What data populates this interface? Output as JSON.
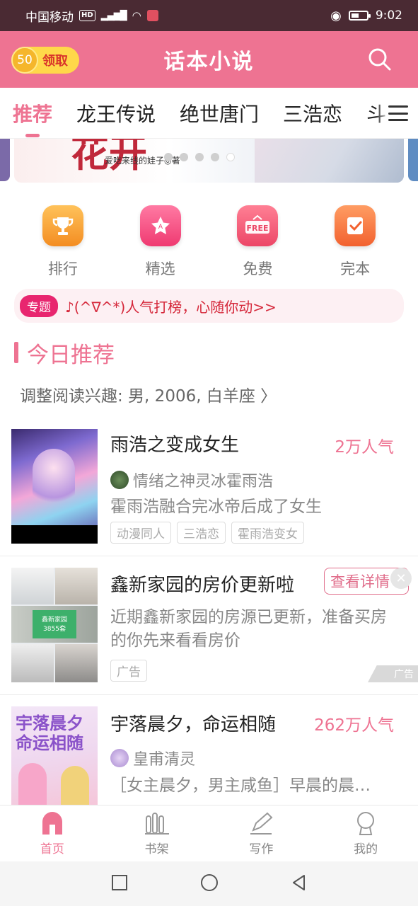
{
  "status_bar": {
    "carrier": "中国移动",
    "hd": "HD",
    "network": "⁴ᴳ",
    "time": "9:02"
  },
  "header": {
    "title": "话本小说",
    "coin_value": "50",
    "coin_label": "领取"
  },
  "tabs": [
    "推荐",
    "龙王传说",
    "绝世唐门",
    "三浩恋",
    "斗"
  ],
  "banner": {
    "title_text": "花开",
    "author_text": "爱吃来线的娃子◎著",
    "dot_count": 5,
    "active_dot": 4
  },
  "categories": [
    {
      "label": "排行",
      "icon": "trophy-icon",
      "color": "#f7a23b"
    },
    {
      "label": "精选",
      "icon": "star-icon",
      "color": "#f25587"
    },
    {
      "label": "免费",
      "icon": "free-icon",
      "color": "#f0577a"
    },
    {
      "label": "完本",
      "icon": "check-icon",
      "color": "#f7723e"
    }
  ],
  "topic": {
    "badge": "专题",
    "text": "♪(^∇^*)人气打榜，心随你动>>"
  },
  "section": {
    "title": "今日推荐",
    "interest": "调整阅读兴趣: 男, 2006, 白羊座 〉"
  },
  "books": [
    {
      "title": "雨浩之变成女生",
      "popularity": "2万人气",
      "author": "情绪之神灵冰霍雨浩",
      "description": "霍雨浩融合完冰帝后成了女生",
      "tags": [
        "动漫同人",
        "三浩恋",
        "霍雨浩变女"
      ]
    },
    {
      "title": "宇落晨夕，命运相随",
      "popularity": "262万人气",
      "author": "皇甫清灵",
      "description": "［女主晨夕，男主咸鱼］早晨的晨…",
      "cover_text": "宇落晨夕命运相随"
    }
  ],
  "ad": {
    "title": "鑫新家园的房价更新啦",
    "button": "查看详情",
    "description_line1": "近期鑫新家园的房源已更新，准备买房",
    "description_line2": "的你先来看看房价",
    "tag": "广告",
    "mark": "广告",
    "cover_caption_1": "鑫新家园",
    "cover_caption_2": "3855套"
  },
  "bottom_nav": [
    {
      "label": "首页",
      "icon": "home-icon",
      "active": true
    },
    {
      "label": "书架",
      "icon": "bookshelf-icon",
      "active": false
    },
    {
      "label": "写作",
      "icon": "pencil-icon",
      "active": false
    },
    {
      "label": "我的",
      "icon": "profile-icon",
      "active": false
    }
  ],
  "colors": {
    "accent": "#ee7392",
    "status_bar": "#4a2a33"
  }
}
